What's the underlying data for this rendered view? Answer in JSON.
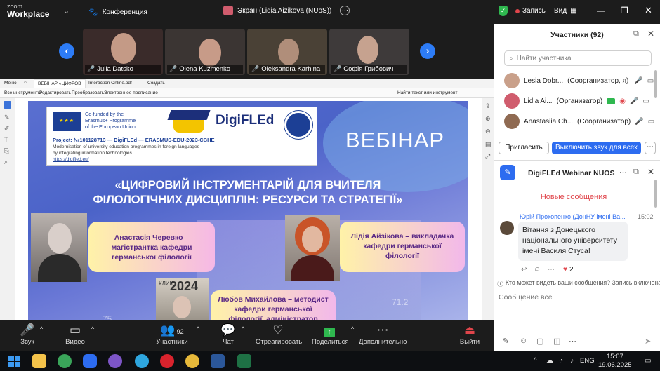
{
  "topbar": {
    "app_name_line1": "zoom",
    "app_name_line2": "Workplace",
    "conference_label": "Конференция",
    "screen_label": "Экран (Lidia Aizikova (NUoS))",
    "record_label": "Запись",
    "view_label": "Вид"
  },
  "thumbnails": [
    {
      "name": "Julia Datsko",
      "bg": "#3a2b2a"
    },
    {
      "name": "Olena Kuzmenko",
      "bg": "#3b3533"
    },
    {
      "name": "Oleksandra Karhina",
      "bg": "#4a4136"
    },
    {
      "name": "Софія Грибович",
      "bg": "#3e3a3a"
    }
  ],
  "pdf": {
    "tabs": [
      "Меню",
      "ВЕБІНАР «ЦИФРОВ",
      "Interaction Online.pdf",
      "Создать"
    ],
    "tools": [
      "Все инструменты",
      "Редактировать",
      "Преобразовать",
      "Электронное подписание"
    ],
    "search": "Найти текст или инструмент"
  },
  "slide": {
    "cofunded": "Co-funded by the Erasmus+ Programme of the European Union",
    "cofunded_l1": "Co-funded by the",
    "cofunded_l2": "Erasmus+ Programme",
    "cofunded_l3": "of the European Union",
    "digifled": "DigiFLEd",
    "project_title": "Project: №101128713 — DigiFLEd — ERASMUS-EDU-2023-CBHE",
    "project_line1": "Modernisation of university education programmes in foreign languages",
    "project_line2": "by integrating information technologies",
    "project_link": "https://digifled.eu/",
    "webinar": "ВЕБІНАР",
    "title_line1": "«ЦИФРОВИЙ ІНСТРУМЕНТАРІЙ ДЛЯ ВЧИТЕЛЯ",
    "title_line2": "ФІЛОЛОГІЧНИХ ДИСЦИПЛІН: РЕСУРСИ ТА СТРАТЕГІЇ»",
    "speaker1_l1": "Анастасія Черевко –",
    "speaker1_l2": "магістрантка кафедри",
    "speaker1_l3": "германської філології",
    "speaker2_l1": "Лідія Айзікова – викладачка",
    "speaker2_l2": "кафедри германської",
    "speaker2_l3": "філології",
    "speaker3_l1": "Любов Михайлова – методист",
    "speaker3_l2": "кафедри германської",
    "speaker3_l3": "філології, адміністратор",
    "badge_year": "2024",
    "badge_word": "КЛИК",
    "bg_number1": "71.2",
    "bg_number2": "75"
  },
  "participants": {
    "title": "Участники (92)",
    "search_placeholder": "Найти участника",
    "list": [
      {
        "name": "Lesia Dobr...",
        "role": "(Соорганизатор, я)",
        "avatar_color": "#c9a08a"
      },
      {
        "name": "Lidia Ai...",
        "role": "(Организатор)",
        "avatar_color": "#d05c6d"
      },
      {
        "name": "Anastasiia Ch...",
        "role": "(Соорганизатор)",
        "avatar_color": "#8f6a52"
      }
    ],
    "invite_label": "Пригласить",
    "mute_all_label": "Выключить звук для всех"
  },
  "chat": {
    "title": "DigiFLEd Webinar NUOS",
    "new_messages": "Новые сообщения",
    "message": {
      "sender": "Юрій Прокопенко (ДонНУ імені Ва...",
      "time": "15:02",
      "text": "Вітання з Донецького національного університету імені Василя Стуса!",
      "line1": "Вітання з Донецького",
      "line2": "національного університету",
      "line3": "імені Василя Стуса!",
      "reactions": "2"
    },
    "visibility_note": "Кто может видеть ваши сообщения? Запись включена",
    "input_placeholder": "Сообщение все"
  },
  "toolbar": {
    "audio": "Звук",
    "video": "Видео",
    "participants": "Участники",
    "participants_count": "92",
    "chat": "Чат",
    "react": "Отреагировать",
    "share": "Поделиться",
    "more": "Дополнительно",
    "leave": "Выйти"
  },
  "taskbar": {
    "lang": "ENG",
    "time": "15:07",
    "date": "19.06.2025"
  }
}
